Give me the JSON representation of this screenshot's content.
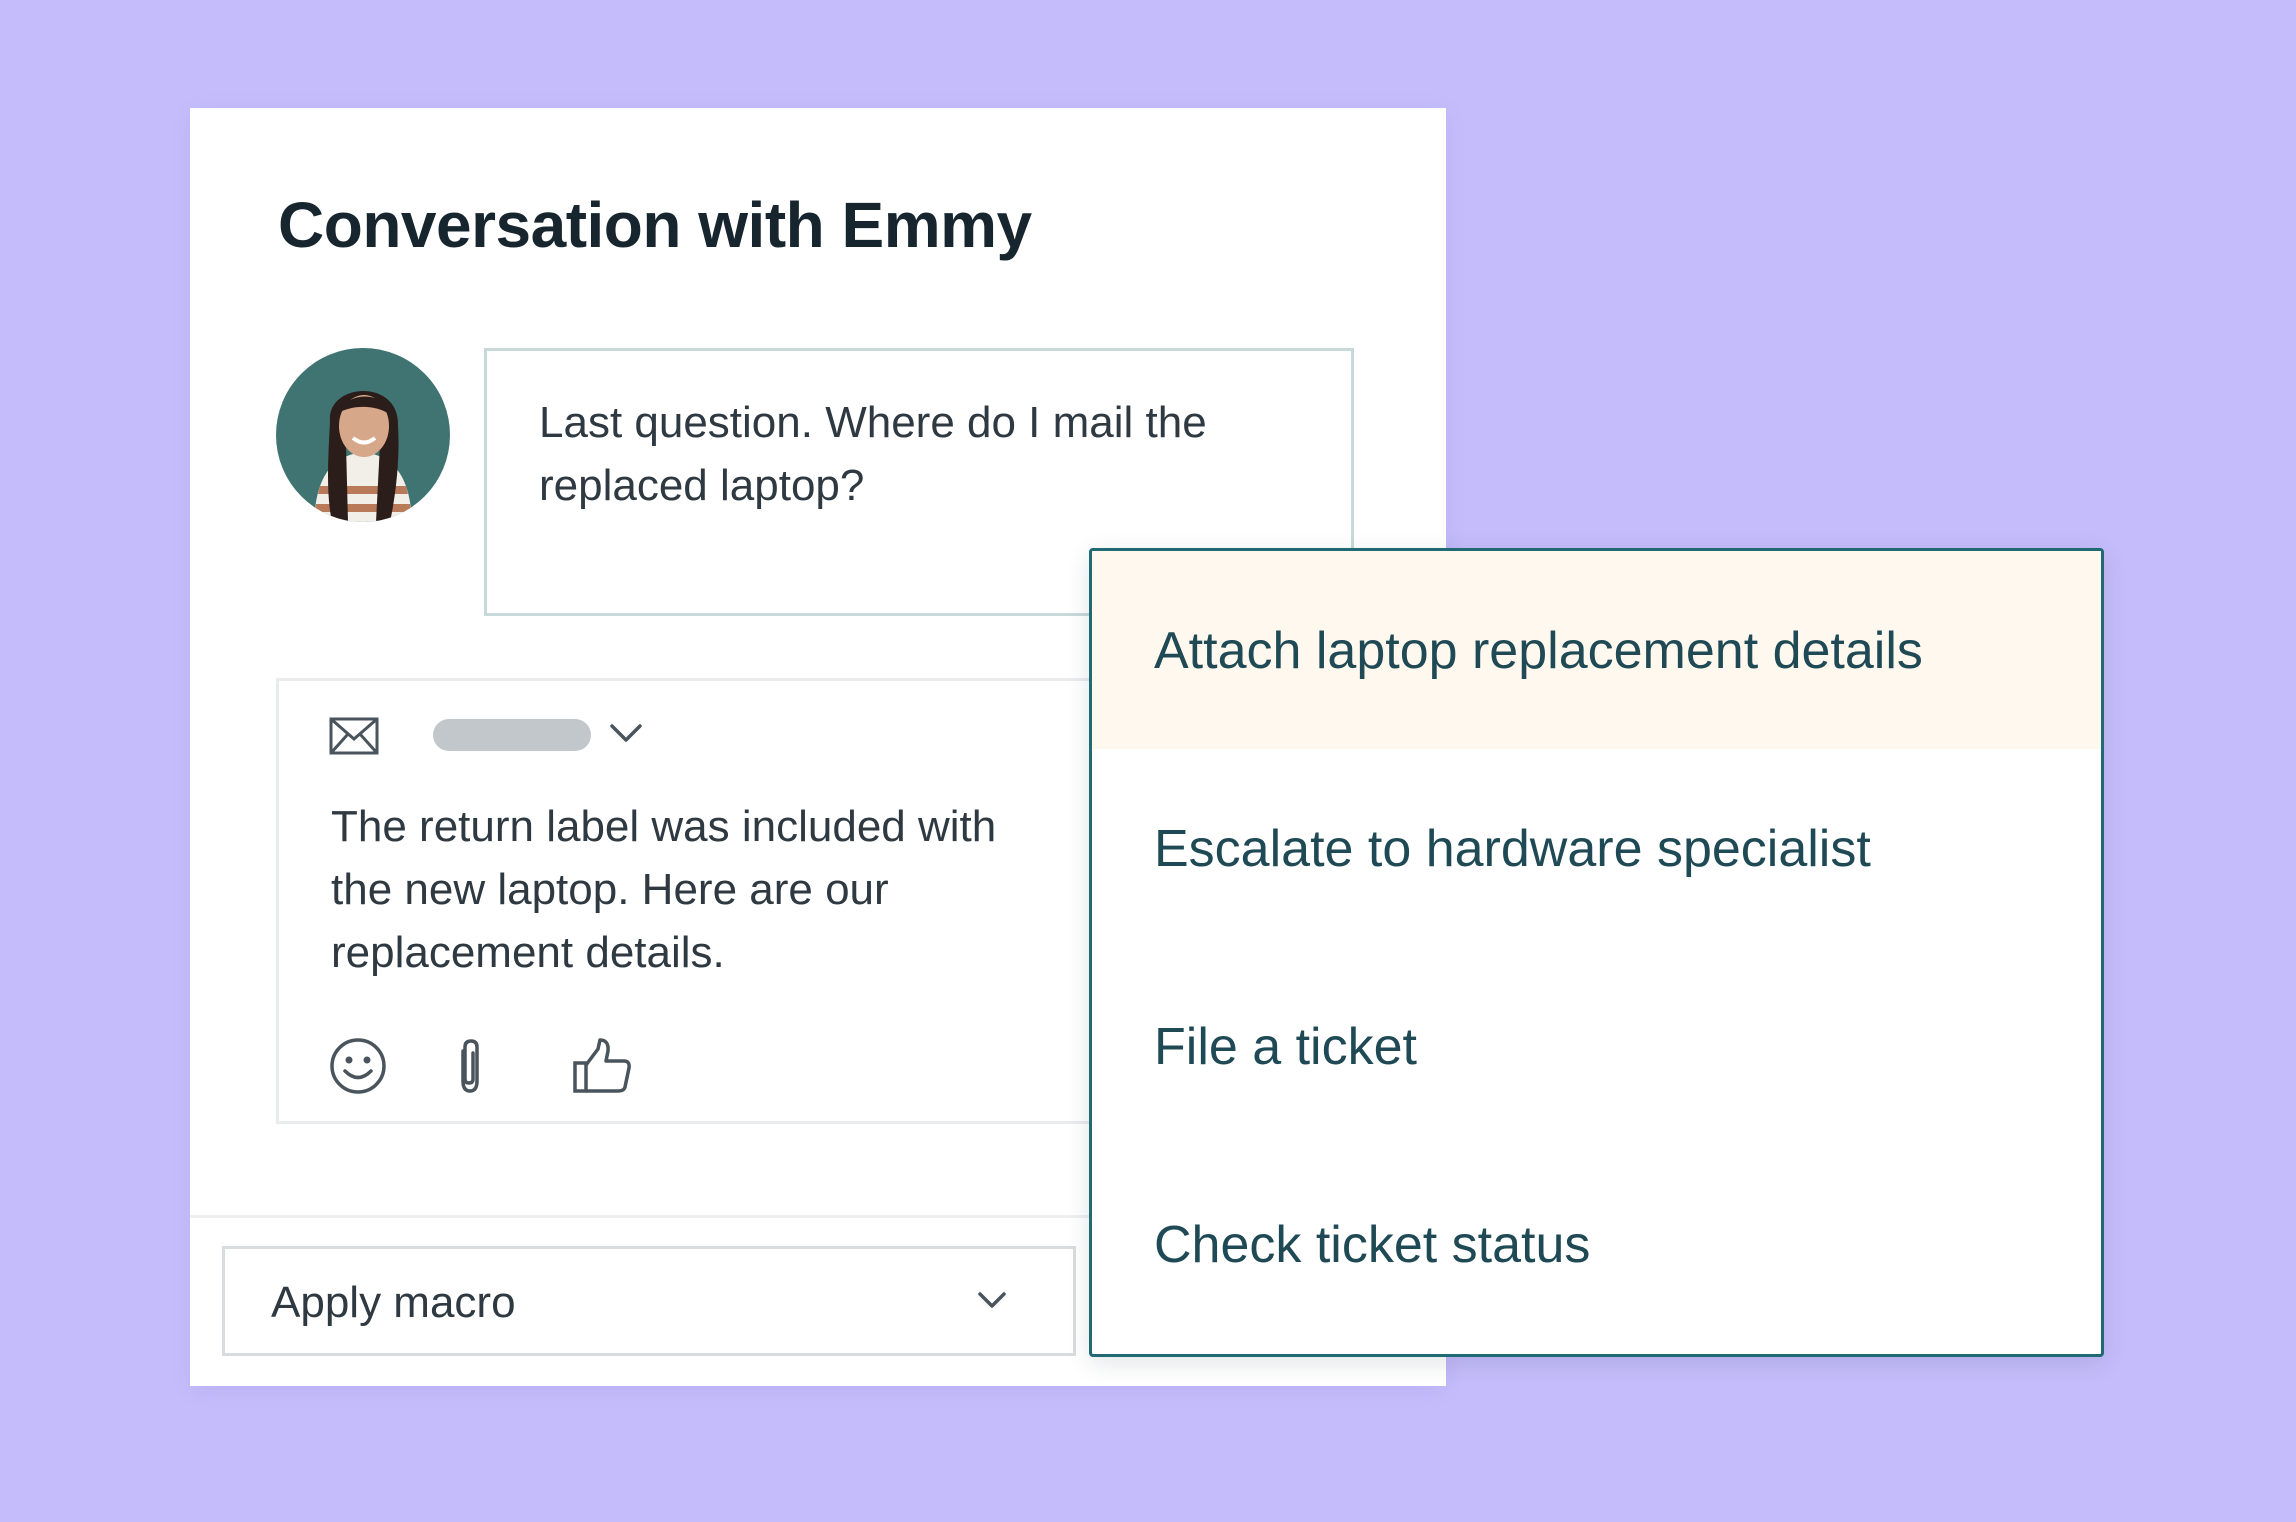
{
  "colors": {
    "background": "#c5bdfb",
    "card": "#ffffff",
    "dropdown_border": "#1f6a73",
    "highlight": "#fff8ee",
    "text": "#2f3941"
  },
  "conversation": {
    "title": "Conversation with Emmy",
    "customer_message": "Last question. Where do I mail the replaced laptop?"
  },
  "composer": {
    "channel_icon": "mail-icon",
    "reply_text": "The return label was included with the new laptop. Here are our replacement details.",
    "tool_icons": [
      "emoji-icon",
      "paperclip-icon",
      "thumbs-up-icon"
    ]
  },
  "macro": {
    "select_label": "Apply macro"
  },
  "macro_options": [
    {
      "label": "Attach laptop replacement details",
      "highlighted": true
    },
    {
      "label": "Escalate to hardware specialist",
      "highlighted": false
    },
    {
      "label": "File a ticket",
      "highlighted": false
    },
    {
      "label": "Check ticket status",
      "highlighted": false
    }
  ]
}
